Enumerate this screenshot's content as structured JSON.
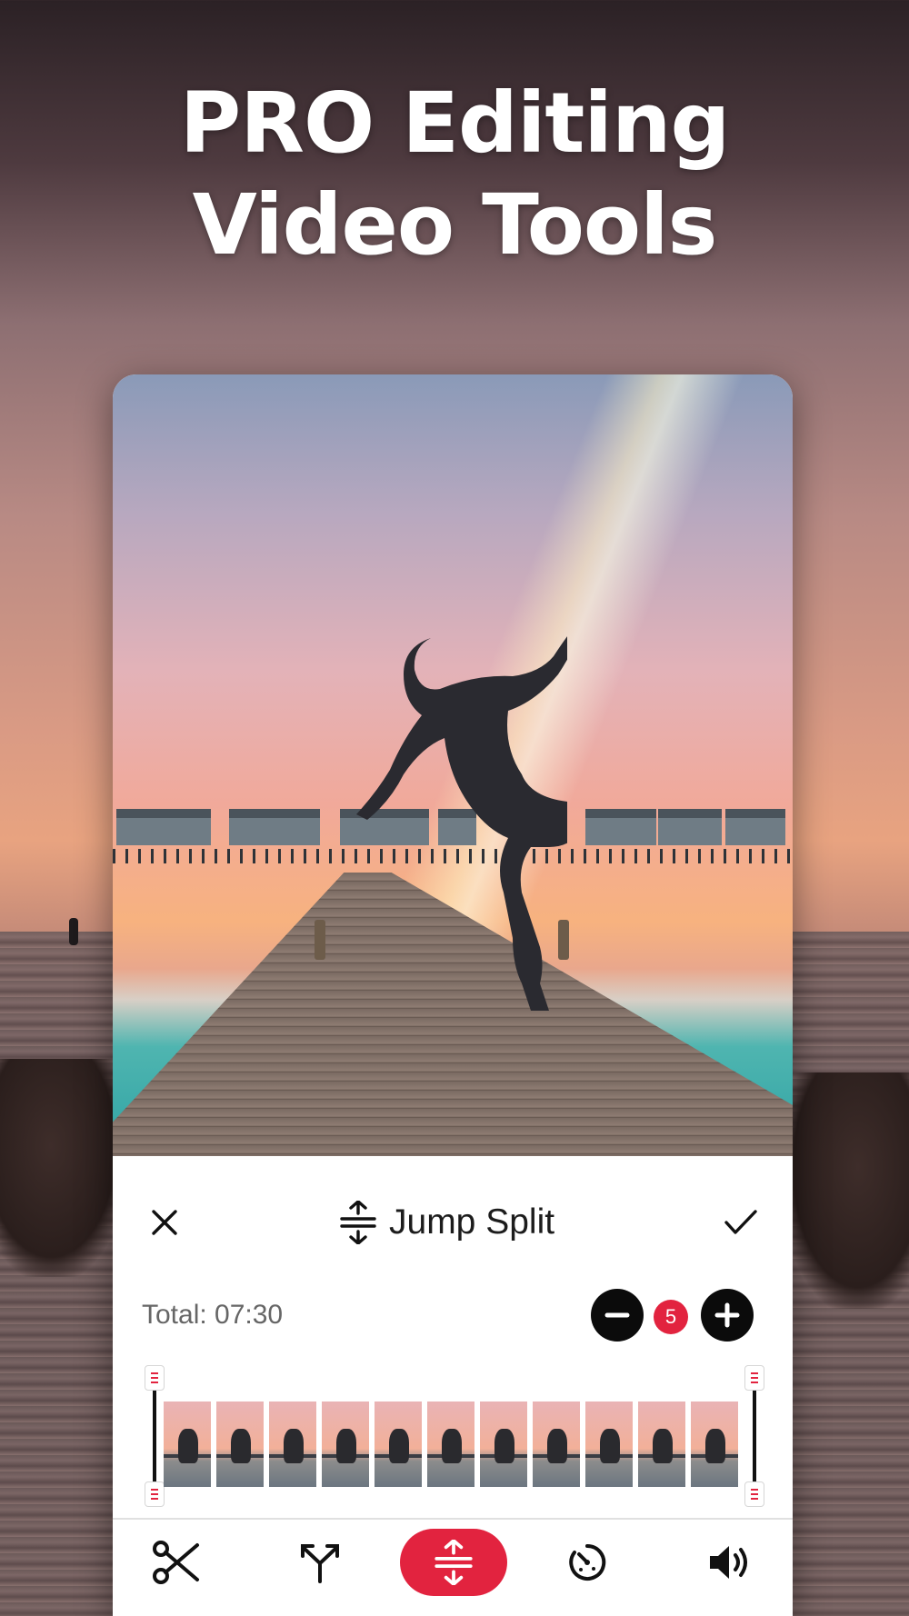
{
  "headline": {
    "line1": "PRO Editing",
    "line2": "Video Tools"
  },
  "editor": {
    "title": "Jump Split",
    "title_icon": "split-icon",
    "close_icon": "close-icon",
    "confirm_icon": "check-icon",
    "total_label": "Total: 07:30",
    "decrease_icon": "minus-icon",
    "increase_icon": "plus-icon",
    "split_count": "5",
    "frame_count": 11
  },
  "toolbar": {
    "tools": [
      {
        "name": "scissors-icon",
        "active": false
      },
      {
        "name": "split-arrows-icon",
        "active": false
      },
      {
        "name": "jump-split-icon",
        "active": true
      },
      {
        "name": "speed-dial-icon",
        "active": false
      },
      {
        "name": "volume-icon",
        "active": false
      }
    ]
  },
  "colors": {
    "accent": "#e2233f",
    "dark": "#0b0b0b",
    "text_secondary": "#666666"
  }
}
